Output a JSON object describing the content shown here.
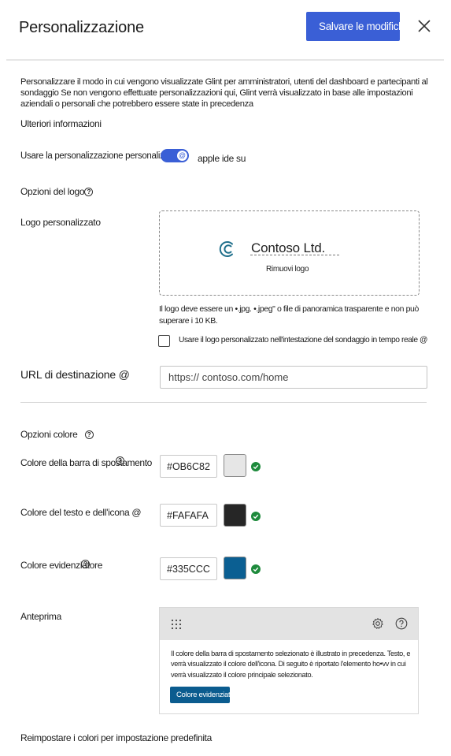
{
  "header": {
    "title": "Personalizzazione",
    "save_label": "Salvare le modifiche"
  },
  "description": {
    "text": "Personalizzare il modo in cui vengono visualizzate Glint per amministratori, utenti del dashboard e partecipanti al sondaggio Se non vengono effettuate personalizzazioni qui, Glint verrà visualizzato in base alle impostazioni aziendali o personali che potrebbero essere state in precedenza",
    "more_link": "Ulteriori informazioni"
  },
  "custom_toggle": {
    "label": "Usare la personalizzazione personalizzata",
    "knob_glyph": "@",
    "suffix": "apple ide su",
    "state": "on"
  },
  "logo": {
    "section_label": "Opzioni del logo",
    "custom_label": "Logo personalizzato",
    "company_name": "Contoso Ltd.",
    "remove_label": "Rimuovi logo",
    "note": "Il logo deve essere un •.jpg. •.jpeg\" o file di panoramica trasparente e non può superare i 10 KB.",
    "checkbox_label": "Usare il logo personalizzato nell'intestazione del sondaggio in tempo reale @",
    "checkbox_checked": false
  },
  "url": {
    "label": "URL di destinazione @",
    "value": "https:// contoso.com/home"
  },
  "colors": {
    "section_label": "Opzioni colore",
    "rows": [
      {
        "label": "Colore della barra di spostamento",
        "hex": "#OB6C82",
        "swatch": "#e6e6e6"
      },
      {
        "label": "Colore del testo e dell'icona @",
        "hex": "#FAFAFA",
        "swatch": "#262626"
      },
      {
        "label": "Colore evidenziatore",
        "hex": "#335CCC",
        "swatch": "#0b5f92"
      }
    ],
    "valid_color": "#1e8a3c"
  },
  "preview": {
    "label": "Anteprima",
    "text": "Il colore della barra di spostamento selezionato è illustrato in precedenza. Testo, e verrà visualizzato il colore dell'icona.  Di seguito è riportato l'elemento ho•vv in cui verrà visualizzato il colore principale selezionato.",
    "button_label": "Colore evidenziatore"
  },
  "reset": {
    "label": "Reimpostare i colori per impostazione predefinita"
  }
}
